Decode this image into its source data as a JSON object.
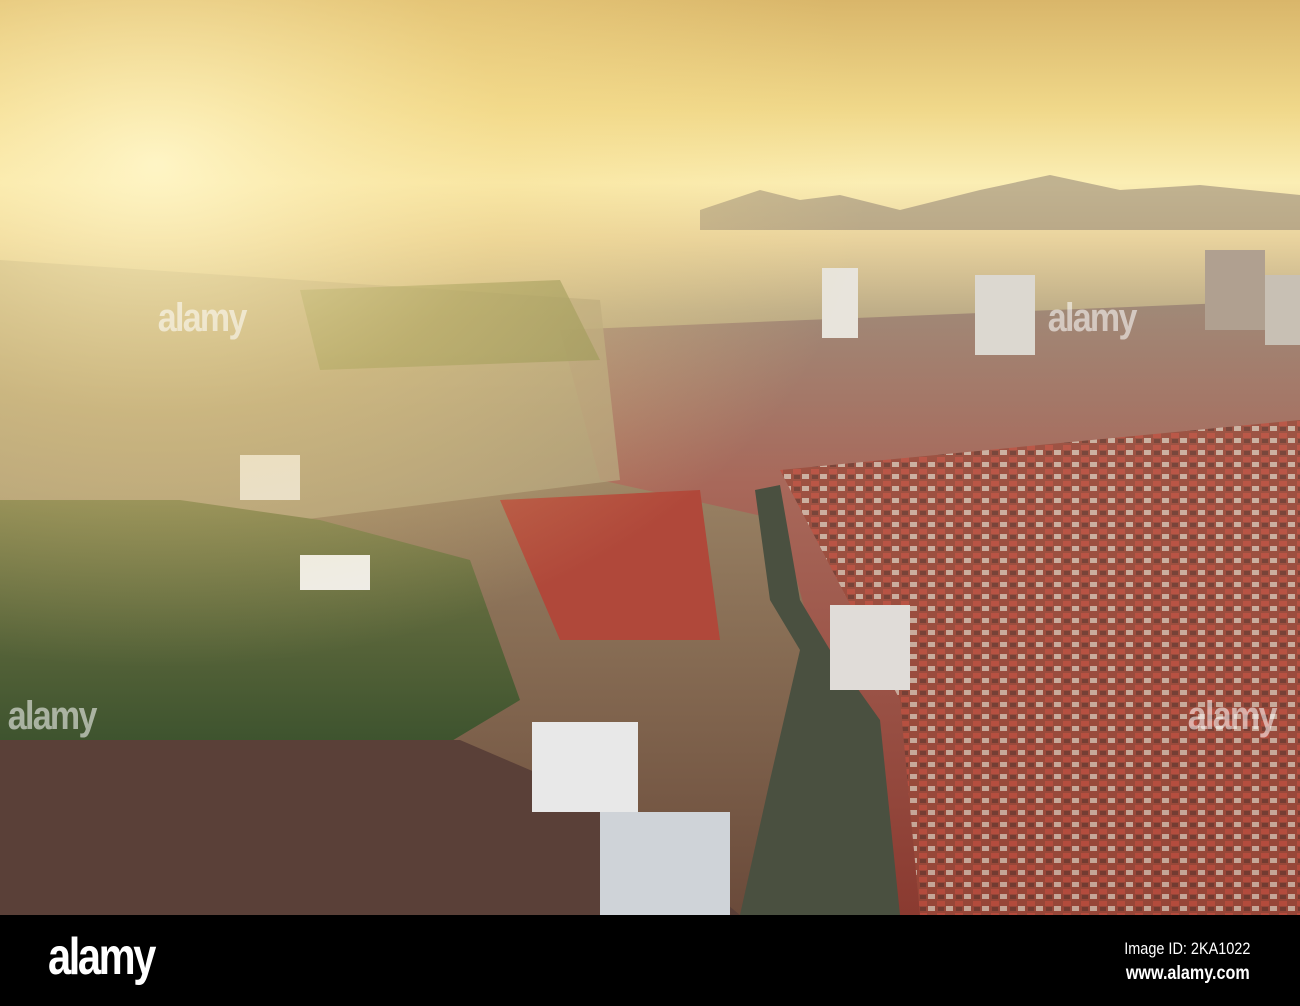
{
  "photo": {
    "subject": "aerial-city-sunrise",
    "watermark_text": "alamy"
  },
  "footer": {
    "logo": "alamy",
    "image_id": "Image ID: 2KA1022",
    "url": "www.alamy.com"
  }
}
